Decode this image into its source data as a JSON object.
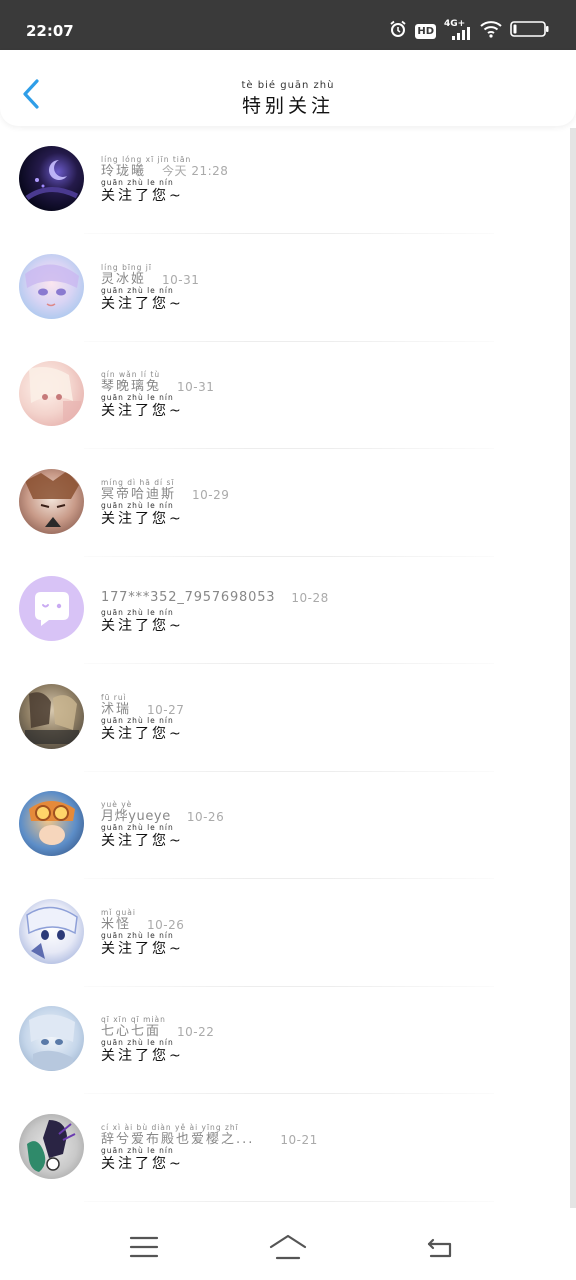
{
  "status_bar": {
    "time": "22:07",
    "hd_label": "HD",
    "network_label": "4G+",
    "icons": [
      "alarm-icon",
      "hd-icon",
      "signal-icon",
      "wifi-icon",
      "battery-icon"
    ]
  },
  "header": {
    "title_pinyin": "tè  bié  guān zhù",
    "title": "特别关注",
    "back_icon": "chevron-left-icon",
    "accent_color": "#2f9ee8"
  },
  "list": {
    "items": [
      {
        "name_pinyin": "líng lóng  xī      jīn  tiān",
        "name": "玲珑曦",
        "time": "今天 21:28",
        "msg_pinyin": "guān zhù   le   nín",
        "msg": "关注了您~",
        "avatar": "avatar-dark-creature"
      },
      {
        "name_pinyin": "líng bīng  jī",
        "name": "灵冰姬",
        "time": "10-31",
        "msg_pinyin": "guān zhù   le   nín",
        "msg": "关注了您~",
        "avatar": "avatar-anime-girl-pastel"
      },
      {
        "name_pinyin": "qín  wǎn   lí   tù",
        "name": "琴晚璃兔",
        "time": "10-31",
        "msg_pinyin": "guān zhù   le   nín",
        "msg": "关注了您~",
        "avatar": "avatar-anime-girl-pink"
      },
      {
        "name_pinyin": "míng  dì   hā   dí   sī",
        "name": "冥帝哈迪斯",
        "time": "10-29",
        "msg_pinyin": "guān zhù   le   nín",
        "msg": "关注了您~",
        "avatar": "avatar-anime-boy-brown"
      },
      {
        "name_pinyin": "",
        "name": "177***352_7957698053",
        "time": "10-28",
        "msg_pinyin": "guān zhù   le   nín",
        "msg": "关注了您~",
        "avatar": "avatar-default-chat"
      },
      {
        "name_pinyin": "fū  ruì",
        "name": "沭瑞",
        "time": "10-27",
        "msg_pinyin": "guān zhù   le   nín",
        "msg": "关注了您~",
        "avatar": "avatar-anime-duo"
      },
      {
        "name_pinyin": "yuè  yè",
        "name": "月烨yueye",
        "time": "10-26",
        "msg_pinyin": "guān zhù   le   nín",
        "msg": "关注了您~",
        "avatar": "avatar-anime-goggles"
      },
      {
        "name_pinyin": "mǐ  guài",
        "name": "米怪",
        "time": "10-26",
        "msg_pinyin": "guān zhù   le   nín",
        "msg": "关注了您~",
        "avatar": "avatar-anime-shark-girl"
      },
      {
        "name_pinyin": "qī  xīn   qī  miàn",
        "name": "七心七面",
        "time": "10-22",
        "msg_pinyin": "guān zhù   le   nín",
        "msg": "关注了您~",
        "avatar": "avatar-anime-girl-blue"
      },
      {
        "name_pinyin": "cí   xì   ài   bù  diàn  yě   ài  yīng zhī",
        "name": "辞兮爱布殿也爱樱之...",
        "time": "10-21",
        "msg_pinyin": "guān zhù   le   nín",
        "msg": "关注了您~",
        "avatar": "avatar-dragon-dark"
      }
    ]
  },
  "nav_bar": {
    "icons": [
      "menu-icon",
      "home-icon",
      "back-icon"
    ]
  }
}
